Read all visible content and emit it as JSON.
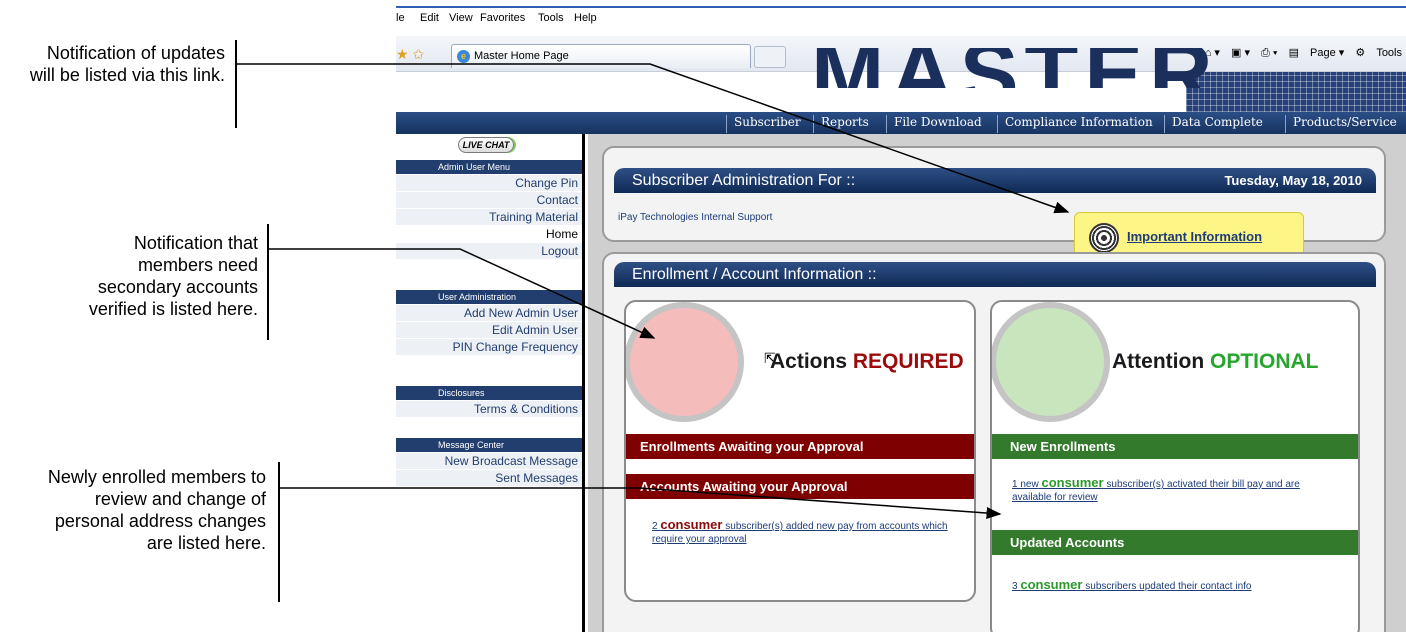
{
  "annotations": [
    {
      "text": "Notification of updates will be listed via this link."
    },
    {
      "text": "Notification that members need secondary accounts verified is listed here."
    },
    {
      "text": "Newly enrolled members  to review and change of personal address changes are listed here."
    }
  ],
  "browser": {
    "menu": [
      "le",
      "Edit",
      "View",
      "Favorites",
      "Tools",
      "Help"
    ],
    "tab_title": "Master Home Page",
    "command_bar": [
      "Page ▾",
      "Tools"
    ]
  },
  "site": {
    "logo_text": "MASTER",
    "nav": [
      "Subscriber",
      "Reports",
      "File Download",
      "Compliance Information",
      "Data Complete",
      "Products/Service"
    ]
  },
  "sidebar": {
    "live_chat": "LIVE CHAT",
    "sections": [
      {
        "heading": "Admin User Menu",
        "items": [
          "Change Pin",
          "Contact",
          "Training Material",
          "Home",
          "Logout"
        ]
      },
      {
        "heading": "User Administration",
        "items": [
          "Add New Admin User",
          "Edit Admin User",
          "PIN Change Frequency"
        ]
      },
      {
        "heading": "Disclosures",
        "items": [
          "Terms & Conditions"
        ]
      },
      {
        "heading": "Message Center",
        "items": [
          "New Broadcast Message",
          "Sent Messages"
        ]
      }
    ]
  },
  "main": {
    "subscriber_admin": {
      "title": "Subscriber Administration For ::",
      "date": "Tuesday, May 18, 2010",
      "org": "iPay Technologies Internal Support",
      "important_link": "Important Information"
    },
    "enrollment": {
      "title": "Enrollment / Account Information ::",
      "actions": {
        "title_prefix": "Actions",
        "title_flag": "REQUIRED",
        "bar1": "Enrollments Awaiting your Approval",
        "bar2": "Accounts Awaiting your Approval",
        "link_count": "2",
        "link_keyword": "consumer",
        "link_text": "subscriber(s) added new pay from accounts which require your approval"
      },
      "attention": {
        "title_prefix": "Attention",
        "title_flag": "OPTIONAL",
        "bar1": "New Enrollments",
        "link1_count": "1 new",
        "link1_keyword": "consumer",
        "link1_text": "subscriber(s) activated their bill pay and are available for review",
        "bar2": "Updated Accounts",
        "link2_count": "3",
        "link2_keyword": "consumer",
        "link2_text": "subscribers updated their contact info"
      }
    }
  }
}
